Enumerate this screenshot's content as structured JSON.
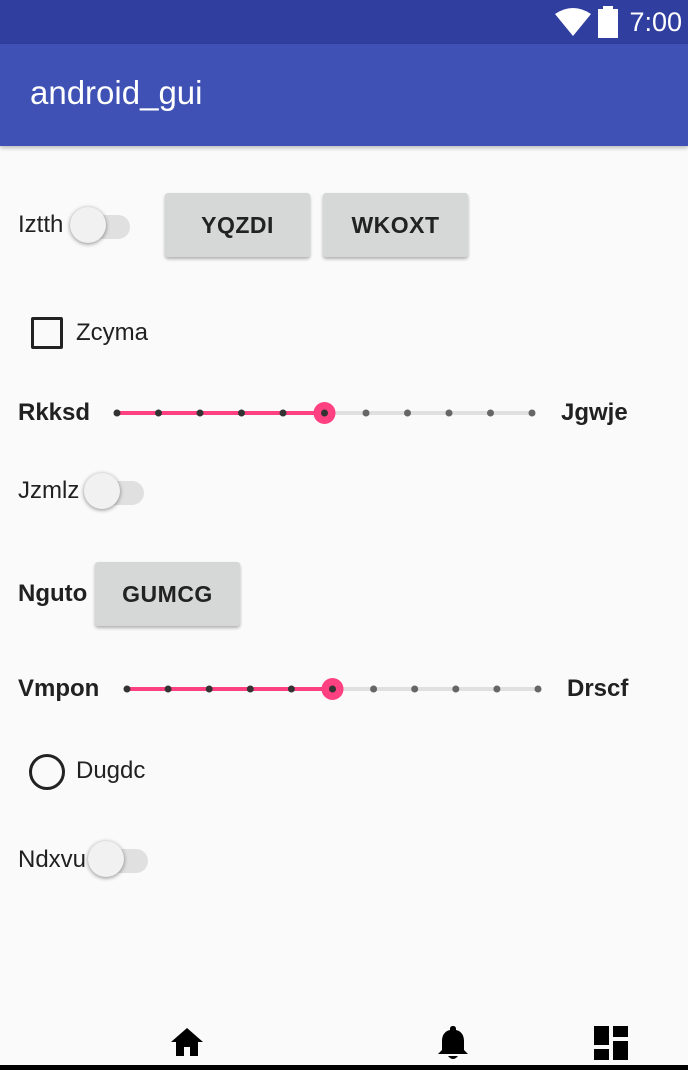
{
  "status_bar": {
    "time": "7:00",
    "icons": [
      "wifi-icon",
      "battery-icon"
    ]
  },
  "app_bar": {
    "title": "android_gui"
  },
  "rows": {
    "row1": {
      "switch_label": "Iztth",
      "switch_on": false,
      "button1": "YQZDI",
      "button2": "WKOXT"
    },
    "row2": {
      "checkbox_label": "Zcyma",
      "checked": false
    },
    "row3": {
      "left_label": "Rkksd",
      "right_label": "Jgwje",
      "steps": 10,
      "value": 5
    },
    "row4": {
      "switch_label": "Jzmlz",
      "switch_on": false
    },
    "row5": {
      "label": "Nguto",
      "button": "GUMCG"
    },
    "row6": {
      "left_label": "Vmpon",
      "right_label": "Drscf",
      "steps": 10,
      "value": 5
    },
    "row7": {
      "radio_label": "Dugdc",
      "selected": false
    },
    "row8": {
      "switch_label": "Ndxvu",
      "switch_on": false
    }
  },
  "colors": {
    "primary": "#3f51b5",
    "primary_dark": "#303f9f",
    "accent": "#ff4081",
    "background": "#fafafa"
  },
  "bottom_nav": {
    "icons": [
      "home-icon",
      "bell-icon",
      "dashboard-icon"
    ]
  }
}
